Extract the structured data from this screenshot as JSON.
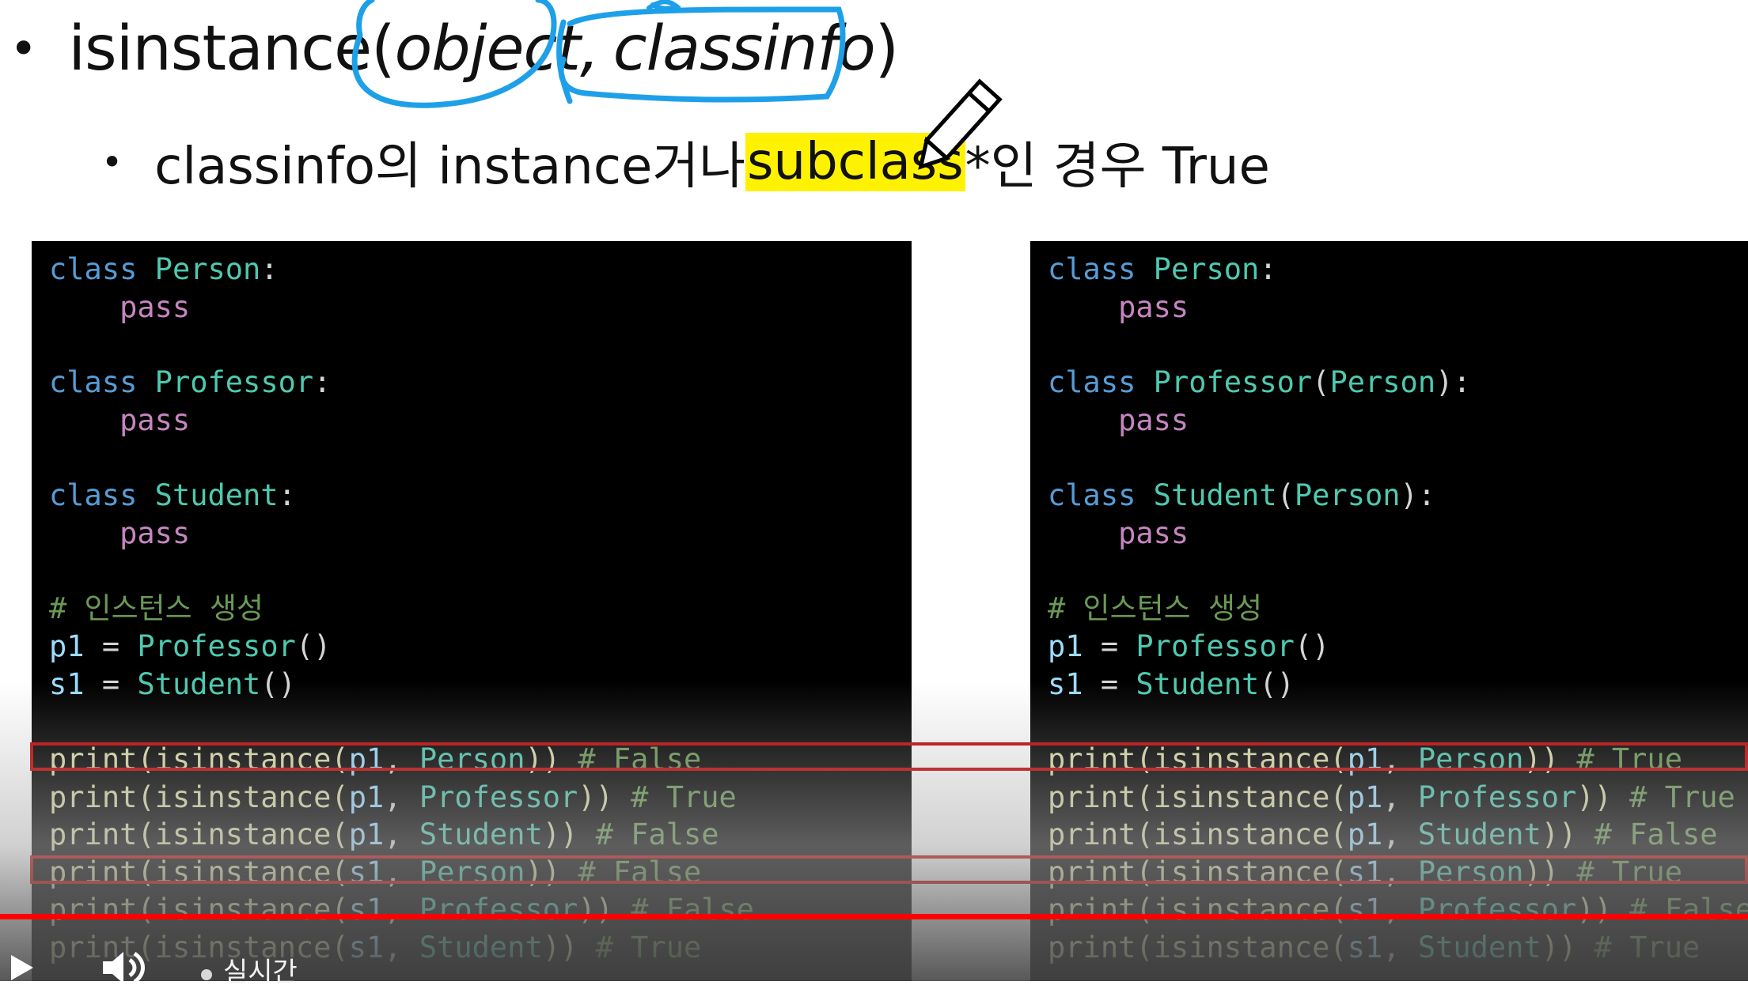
{
  "title": {
    "func": "isinstance(",
    "arg1": "object",
    "sep": ",",
    "arg2": "classinfo",
    "close": ")"
  },
  "subtitle": {
    "before": "classinfo의 instance거나 ",
    "highlight": "subclass",
    "after": "*인 경우 True"
  },
  "left_code": {
    "c1_kw": "class",
    "c1_name": "Person",
    "c1_colon": ":",
    "p1": "pass",
    "c2_kw": "class",
    "c2_name": "Professor",
    "c2_colon": ":",
    "p2": "pass",
    "c3_kw": "class",
    "c3_name": "Student",
    "c3_colon": ":",
    "p3": "pass",
    "comment": "# 인스턴스 생성",
    "a1_var": "p1",
    "a1_eq": " = ",
    "a1_cls": "Professor",
    "a1_par": "()",
    "a2_var": "s1",
    "a2_eq": " = ",
    "a2_cls": "Student",
    "a2_par": "()",
    "r1_fn": "print(isinstance(",
    "r1_obj": "p1",
    "r1_sep": ", ",
    "r1_cls": "Person",
    "r1_close": "))",
    "r1_com": " # False",
    "r2_fn": "print(isinstance(",
    "r2_obj": "p1",
    "r2_sep": ", ",
    "r2_cls": "Professor",
    "r2_close": "))",
    "r2_com": " # True",
    "r3_fn": "print(isinstance(",
    "r3_obj": "p1",
    "r3_sep": ", ",
    "r3_cls": "Student",
    "r3_close": "))",
    "r3_com": " # False",
    "r4_fn": "print(isinstance(",
    "r4_obj": "s1",
    "r4_sep": ", ",
    "r4_cls": "Person",
    "r4_close": "))",
    "r4_com": " # False",
    "r5_fn": "print(isinstance(",
    "r5_obj": "s1",
    "r5_sep": ", ",
    "r5_cls": "Professor",
    "r5_close": "))",
    "r5_com": " # False",
    "r6_fn": "print(isinstance(",
    "r6_obj": "s1",
    "r6_sep": ", ",
    "r6_cls": "Student",
    "r6_close": "))",
    "r6_com": " # True"
  },
  "right_code": {
    "c1_kw": "class",
    "c1_name": "Person",
    "c1_colon": ":",
    "p1": "pass",
    "c2_kw": "class",
    "c2_name": "Professor",
    "c2_open": "(",
    "c2_base": "Person",
    "c2_close": "):",
    "p2": "pass",
    "c3_kw": "class",
    "c3_name": "Student",
    "c3_open": "(",
    "c3_base": "Person",
    "c3_close": "):",
    "p3": "pass",
    "comment": "# 인스턴스 생성",
    "a1_var": "p1",
    "a1_eq": " = ",
    "a1_cls": "Professor",
    "a1_par": "()",
    "a2_var": "s1",
    "a2_eq": " = ",
    "a2_cls": "Student",
    "a2_par": "()",
    "r1_fn": "print(isinstance(",
    "r1_obj": "p1",
    "r1_sep": ", ",
    "r1_cls": "Person",
    "r1_close": "))",
    "r1_com": " # True",
    "r2_fn": "print(isinstance(",
    "r2_obj": "p1",
    "r2_sep": ", ",
    "r2_cls": "Professor",
    "r2_close": "))",
    "r2_com": " # True",
    "r3_fn": "print(isinstance(",
    "r3_obj": "p1",
    "r3_sep": ", ",
    "r3_cls": "Student",
    "r3_close": "))",
    "r3_com": " # False",
    "r4_fn": "print(isinstance(",
    "r4_obj": "s1",
    "r4_sep": ", ",
    "r4_cls": "Person",
    "r4_close": "))",
    "r4_com": " # True",
    "r5_fn": "print(isinstance(",
    "r5_obj": "s1",
    "r5_sep": ", ",
    "r5_cls": "Professor",
    "r5_close": "))",
    "r5_com": " # False",
    "r6_fn": "print(isinstance(",
    "r6_obj": "s1",
    "r6_sep": ", ",
    "r6_cls": "Student",
    "r6_close": "))",
    "r6_com": " # True"
  },
  "player": {
    "live_label": "실시간",
    "progress_color": "#ff0000"
  },
  "colors": {
    "annotation_pen": "#1ea0e8",
    "highlight": "#fff200",
    "row_box": "#c40000"
  },
  "icons": [
    "pencil-cursor-icon",
    "play-icon",
    "volume-icon"
  ]
}
